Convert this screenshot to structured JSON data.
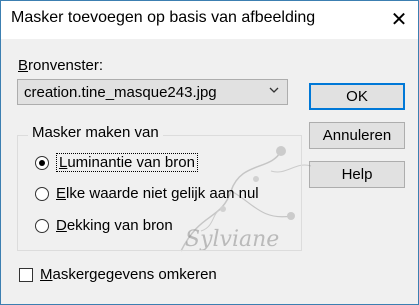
{
  "window": {
    "title": "Masker toevoegen op basis van afbeelding"
  },
  "source": {
    "label_prefix": "B",
    "label_rest": "ronvenster:",
    "selected_value": "creation.tine_masque243.jpg"
  },
  "buttons": {
    "ok": "OK",
    "cancel": "Annuleren",
    "help": "Help"
  },
  "group": {
    "legend": "Masker maken van",
    "options": [
      {
        "prefix": "L",
        "rest": "uminantie van bron",
        "checked": true
      },
      {
        "prefix": "E",
        "rest": "lke waarde niet gelijk aan nul",
        "checked": false
      },
      {
        "prefix": "D",
        "rest": "ekking van bron",
        "checked": false
      }
    ]
  },
  "invert": {
    "prefix": "M",
    "rest": "askergegevens omkeren",
    "checked": false
  },
  "watermark": {
    "text": "Sylviane"
  },
  "icons": {
    "close": "close-icon",
    "dropdown": "chevron-down-icon"
  }
}
